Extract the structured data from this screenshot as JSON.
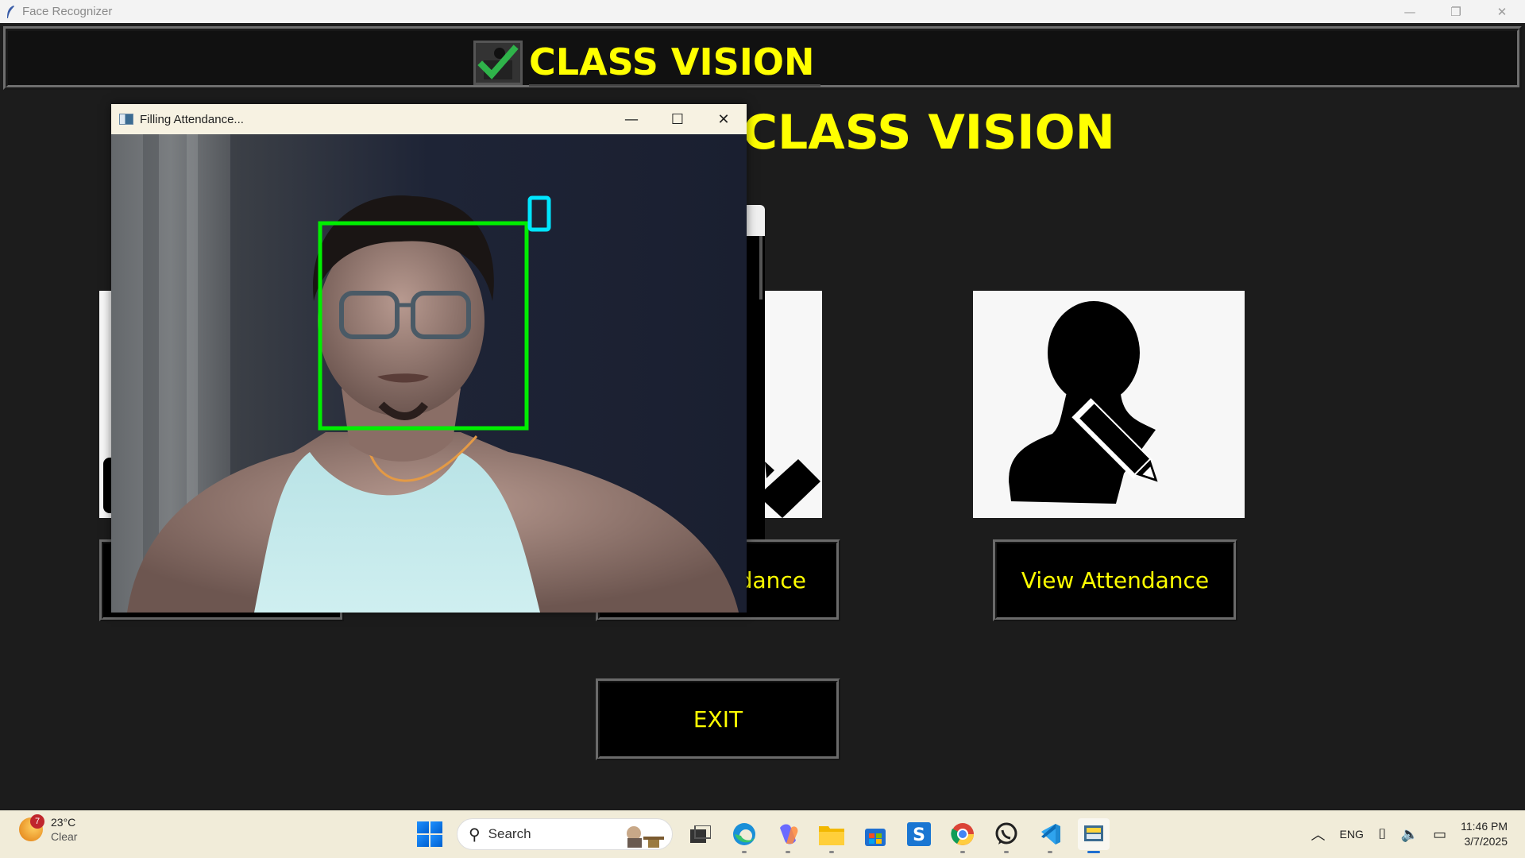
{
  "window": {
    "title": "Face Recognizer",
    "controls": {
      "minimize": "—",
      "restore": "❐",
      "close": "✕"
    }
  },
  "header": {
    "title": "CLASS VISION",
    "logo_icon": "checkmark-person-icon"
  },
  "main": {
    "big_title": "CLASS VISION",
    "cards": [
      {
        "icon": "partial-icon"
      },
      {
        "icon": "checkmark-icon"
      },
      {
        "icon": "user-edit-icon"
      }
    ],
    "buttons": {
      "take_attendance_label": "dance",
      "view_attendance_label": "View Attendance",
      "exit_label": "EXIT"
    },
    "colors": {
      "accent": "#ffff00",
      "background": "#1c1c1c",
      "button_bg": "#000000"
    }
  },
  "popup": {
    "title": "Filling Attendance...",
    "controls": {
      "minimize": "—",
      "maximize": "☐",
      "close": "✕"
    },
    "detection_box_color": "#00ee00",
    "marker_color": "#00e5ff"
  },
  "taskbar": {
    "weather": {
      "badge": "7",
      "temp": "23°C",
      "condition": "Clear"
    },
    "search_placeholder": "Search",
    "apps": [
      "task-view-icon",
      "edge-icon",
      "copilot-icon",
      "file-explorer-icon",
      "store-icon",
      "s-app-icon",
      "chrome-icon",
      "whatsapp-icon",
      "vscode-icon",
      "python-app-icon"
    ],
    "tray": {
      "language": "ENG",
      "time": "11:46 PM",
      "date": "3/7/2025"
    }
  }
}
